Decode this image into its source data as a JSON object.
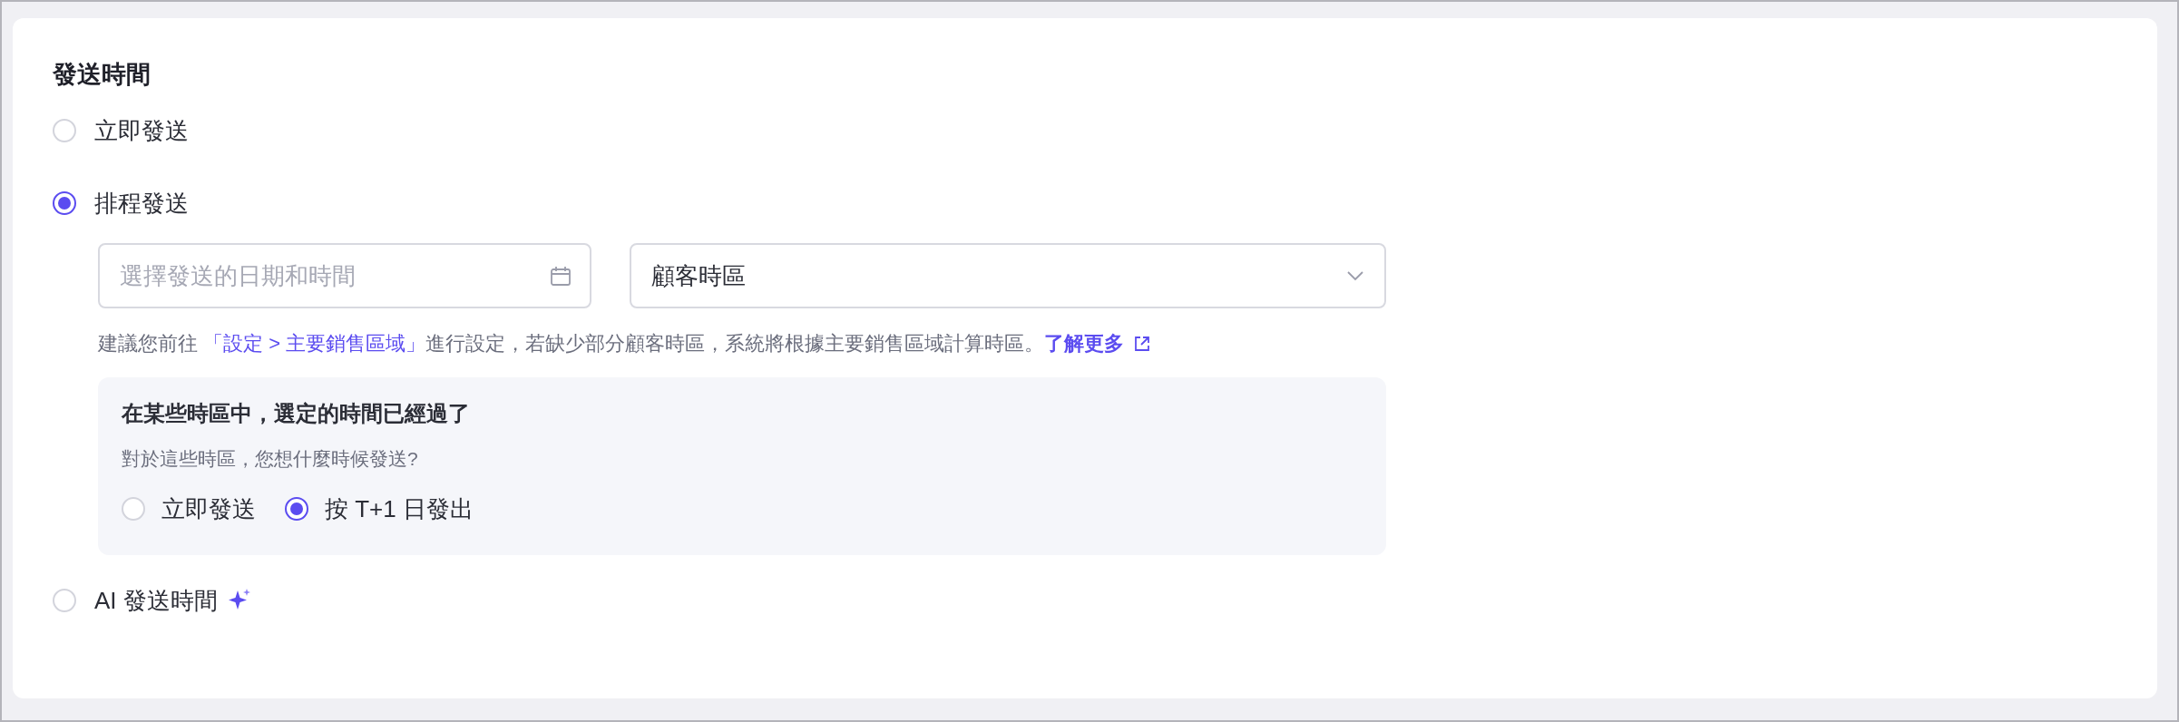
{
  "section_title": "發送時間",
  "options": [
    {
      "kind": "plain",
      "label": "立即發送",
      "selected": false
    },
    {
      "kind": "schedule",
      "label": "排程發送",
      "selected": true
    },
    {
      "kind": "ai",
      "label": "AI 發送時間",
      "selected": false
    }
  ],
  "schedule": {
    "date_field": {
      "placeholder": "選擇發送的日期和時間"
    },
    "timezone_select": {
      "value": "顧客時區"
    },
    "hint": {
      "before": "建議您前往 ",
      "link": "「設定 > 主要銷售區域」",
      "after": "進行設定，若缺少部分顧客時區，系統將根據主要銷售區域計算時區。",
      "learn_more": "了解更多"
    },
    "past_time_box": {
      "title": "在某些時區中，選定的時間已經過了",
      "question": "對於這些時區，您想什麼時候發送?",
      "options": [
        {
          "label": "立即發送",
          "selected": false
        },
        {
          "label": "按 T+1 日發出",
          "selected": true
        }
      ]
    }
  }
}
